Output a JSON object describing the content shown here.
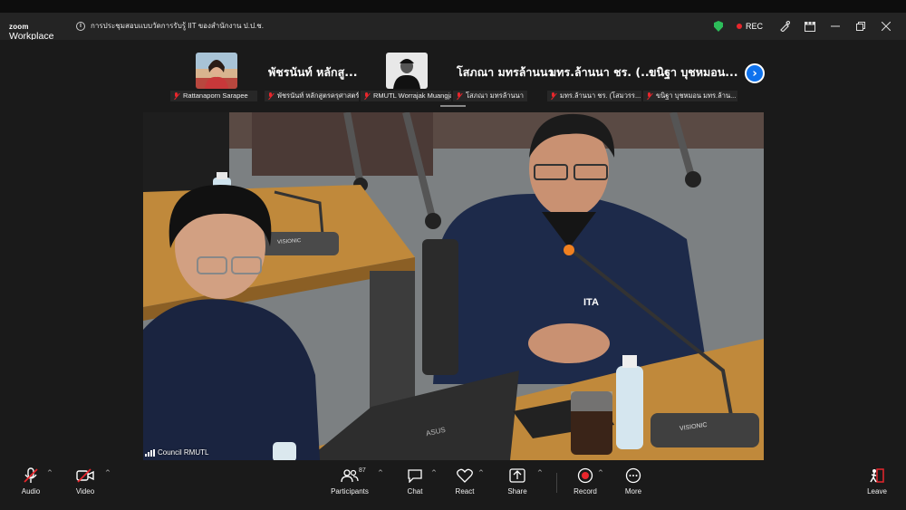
{
  "app": {
    "brand_top": "zoom",
    "brand_bottom": "Workplace",
    "meeting_title": "การประชุมสอบแบบวัดการรับรู้ IIT ของสำนักงาน ป.ป.ช.",
    "rec_label": "REC",
    "colors": {
      "accent": "#0e72ed",
      "rec": "#e8262c",
      "secure": "#2dbd5a"
    }
  },
  "gallery": {
    "tiles": [
      {
        "label": "Rattanaporn Sarapee",
        "bigname": ""
      },
      {
        "label": "พัชรนันท์ หลักสูตรครุศาสตร์...",
        "bigname": "พัชรนันท์  หลักสู..."
      },
      {
        "label": "RMUTL Worrajak Muangjai",
        "bigname": ""
      },
      {
        "label": "โสภณา มทรล้านนา",
        "bigname": "โสภณา มทรล้านนา"
      },
      {
        "label": "มทร.ล้านนา ชร. (โสมวรร...",
        "bigname": "มทร.ล้านนา ชร. (..."
      },
      {
        "label": "ขนิฐา บุชหมอน มทร.ล้าน...",
        "bigname": "ขนิฐา  บุชหมอน..."
      }
    ]
  },
  "video": {
    "speaker": "Council RMUTL",
    "mic_brand": "VISIONIC",
    "laptop_brand": "ASUS",
    "shirt_logo": "ITA"
  },
  "toolbar": {
    "audio": "Audio",
    "video": "Video",
    "participants": "Participants",
    "participants_count": "87",
    "chat": "Chat",
    "react": "React",
    "share": "Share",
    "record": "Record",
    "more": "More",
    "leave": "Leave"
  }
}
